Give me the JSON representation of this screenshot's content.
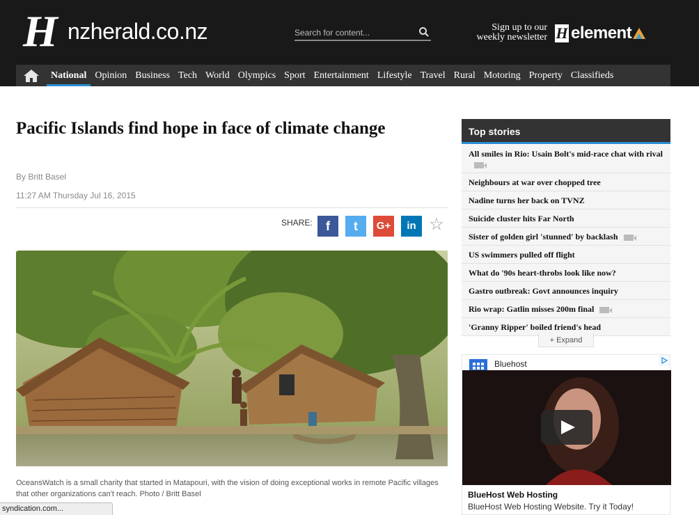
{
  "header": {
    "logo_text": "nzherald.co.nz",
    "logo_mark": "H",
    "search_placeholder": "Search for content...",
    "newsletter_line1": "Sign up to our",
    "newsletter_line2": "weekly newsletter",
    "element_text": "element"
  },
  "nav": {
    "items": [
      "National",
      "Opinion",
      "Business",
      "Tech",
      "World",
      "Olympics",
      "Sport",
      "Entertainment",
      "Lifestyle",
      "Travel",
      "Rural",
      "Motoring",
      "Property",
      "Classifieds"
    ],
    "active": "National"
  },
  "article": {
    "headline": "Pacific Islands find hope in face of climate change",
    "byline": "By Britt Basel",
    "timestamp": "11:27 AM Thursday Jul 16, 2015",
    "share_label": "SHARE:",
    "share_buttons": [
      {
        "name": "facebook",
        "glyph": "f",
        "color": "#3b5998"
      },
      {
        "name": "twitter",
        "glyph": "t",
        "color": "#55acee"
      },
      {
        "name": "google-plus",
        "glyph": "G+",
        "color": "#dd4b39"
      },
      {
        "name": "linkedin",
        "glyph": "in",
        "color": "#0077b5"
      }
    ],
    "caption": "OceansWatch is a small charity that started in Matapouri, with the vision of doing exceptional works in remote Pacific villages that other organizations can't reach. Photo / Britt Basel"
  },
  "sidebar": {
    "title": "Top stories",
    "stories": [
      {
        "text": "All smiles in Rio: Usain Bolt's mid-race chat with rival",
        "video": true
      },
      {
        "text": "Neighbours at war over chopped tree",
        "video": false
      },
      {
        "text": "Nadine turns her back on TVNZ",
        "video": false
      },
      {
        "text": "Suicide cluster hits Far North",
        "video": false
      },
      {
        "text": "Sister of golden girl 'stunned' by backlash",
        "video": true
      },
      {
        "text": "US swimmers pulled off flight",
        "video": false
      },
      {
        "text": "What do '90s heart-throbs look like now?",
        "video": false
      },
      {
        "text": "Gastro outbreak: Govt announces inquiry",
        "video": false
      },
      {
        "text": "Rio wrap: Gatlin misses 200m final",
        "video": true
      },
      {
        "text": "'Granny Ripper' boiled friend's head",
        "video": false
      }
    ],
    "expand_label": "+ Expand"
  },
  "ad": {
    "title": "Bluehost",
    "headline": "BlueHost Web Hosting",
    "description": "BlueHost Web Hosting Website. Try it Today!"
  },
  "status_bar": "syndication.com..."
}
